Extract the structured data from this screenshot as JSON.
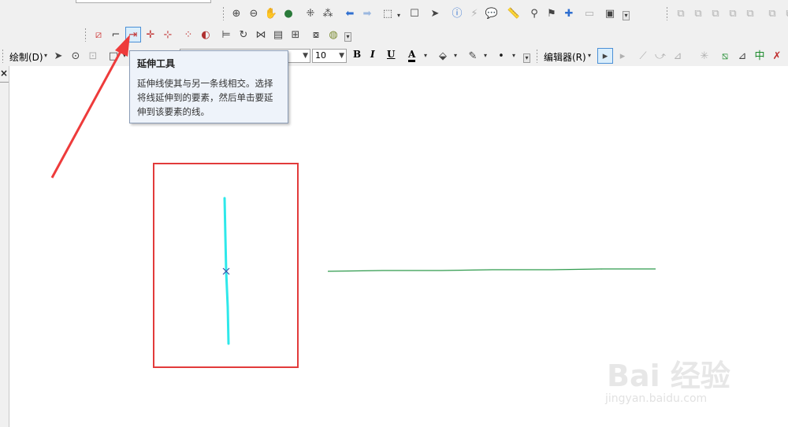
{
  "menus": {
    "draw": "绘制(D)",
    "editor": "编辑器(R)"
  },
  "font_size": "10",
  "font_name": "",
  "format": {
    "bold": "B",
    "italic": "I",
    "underline": "U",
    "font_color": "A"
  },
  "tooltip": {
    "title": "延伸工具",
    "body": "延伸线使其与另一条线相交。选择将线延伸到的要素，然后单击要延伸到该要素的线。"
  },
  "panel": {
    "close": "×"
  },
  "watermark": {
    "main": "Bai 经验",
    "sub": "jingyan.baidu.com"
  },
  "colors": {
    "selected_line": "#2ee8ea",
    "target_line": "#2e9a4c",
    "highlight_box": "#e23b3b",
    "arrow": "#ee3b3b",
    "vertex_marker": "#3a4fa8"
  },
  "icons": {
    "zoom_in": "zoom-in-icon",
    "zoom_out": "zoom-out-icon",
    "pan": "pan-hand-icon",
    "globe": "full-extent-icon",
    "identify": "identify-icon",
    "find": "binoculars-icon",
    "extend": "extend-tool-icon",
    "trim": "trim-tool-icon"
  }
}
